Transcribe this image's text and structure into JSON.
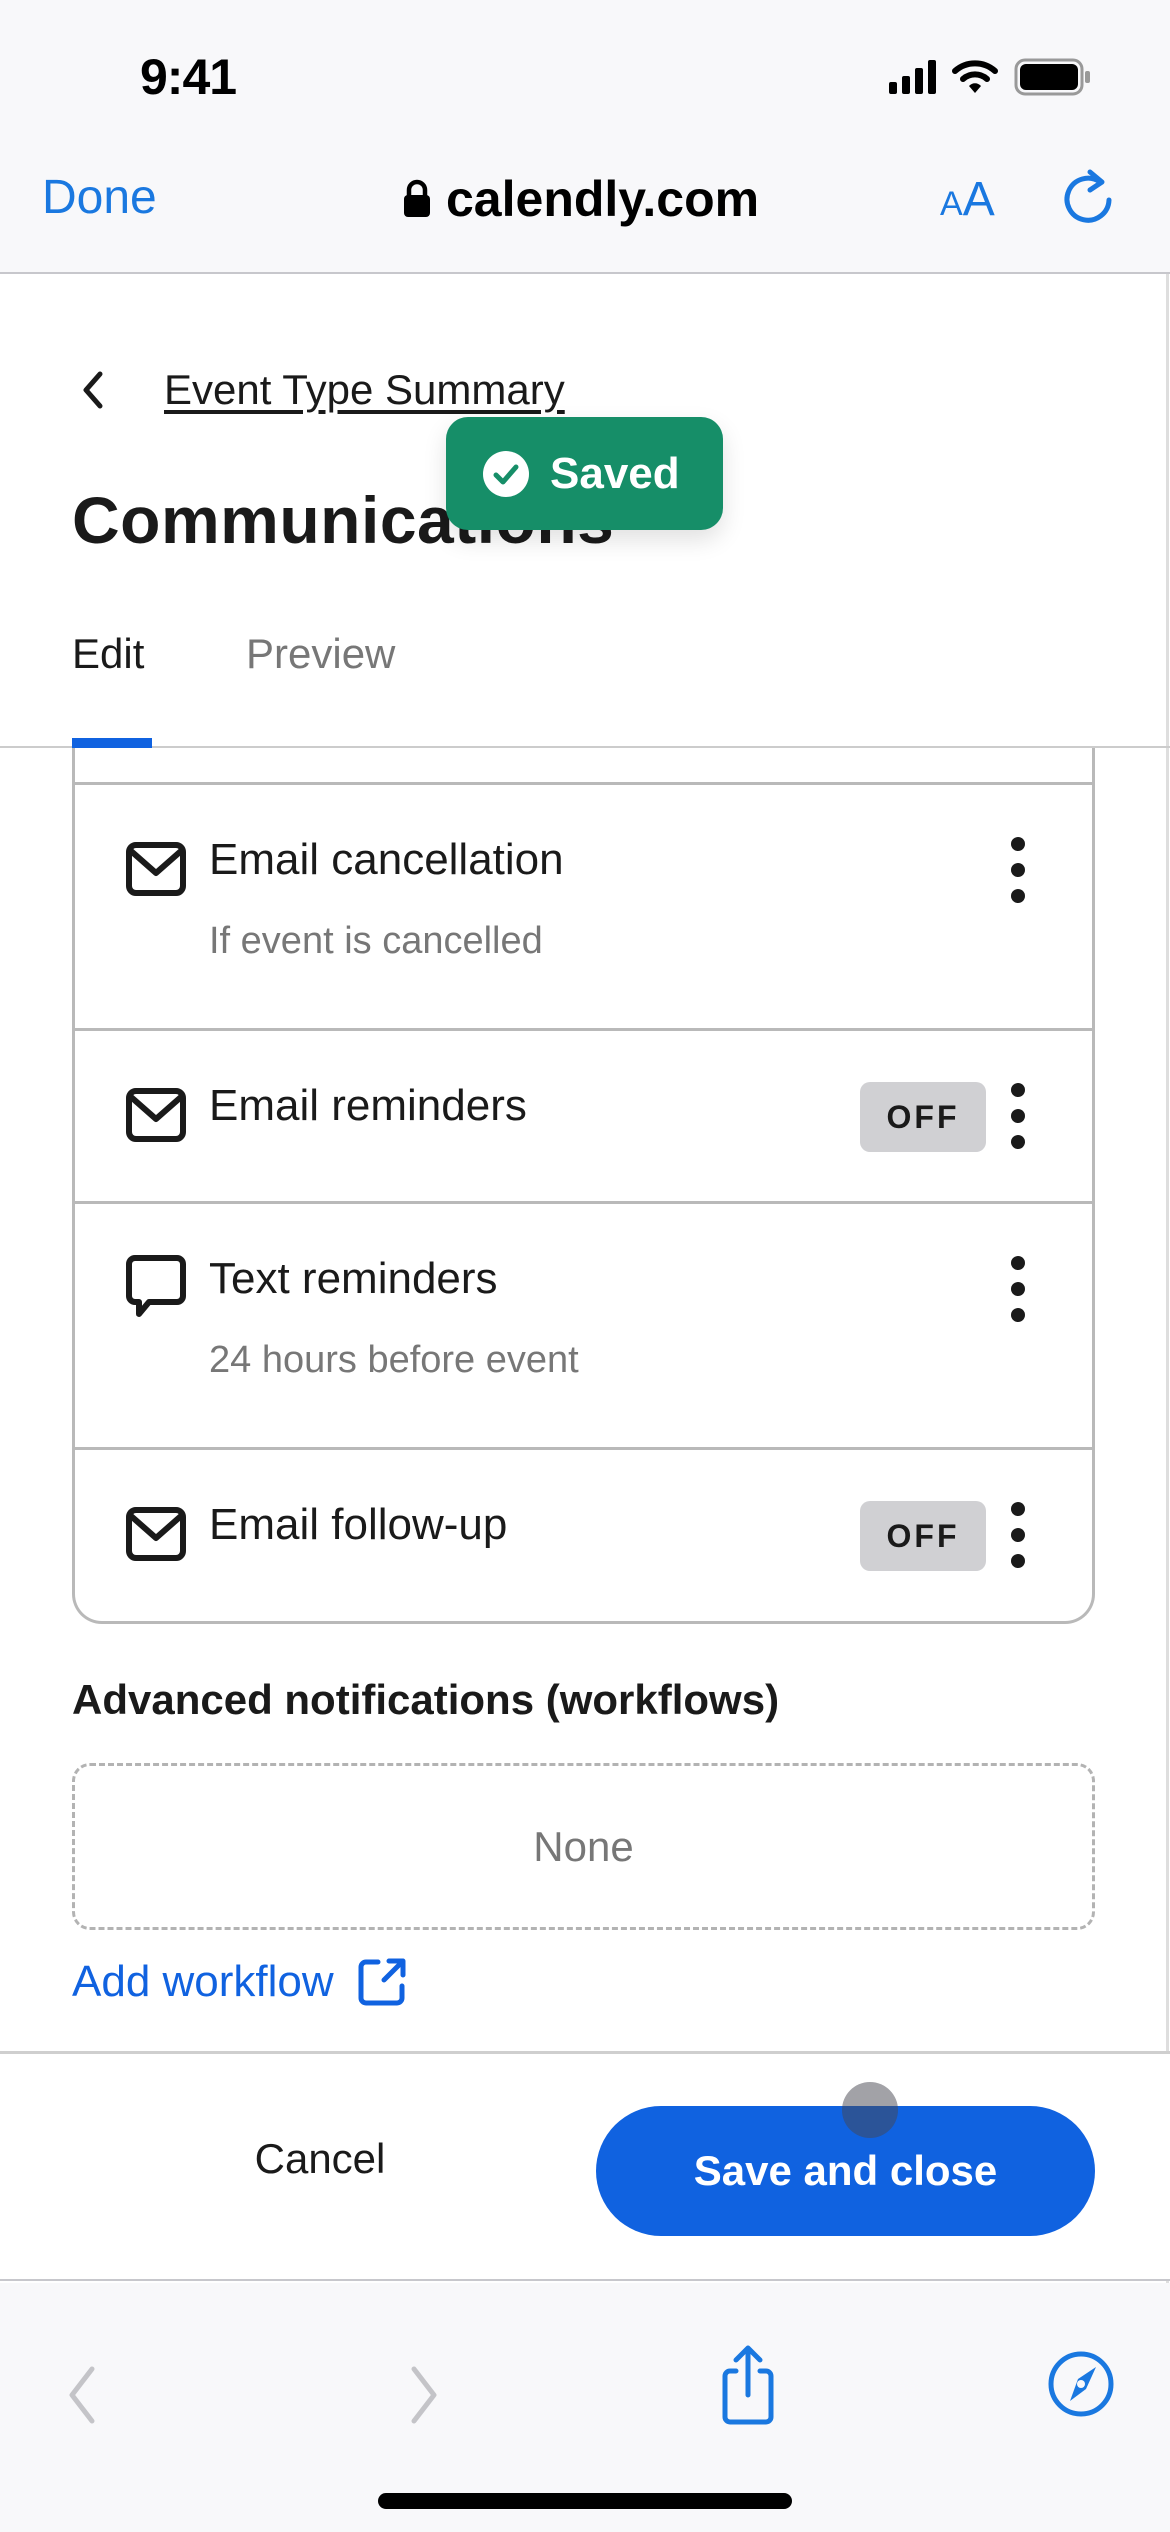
{
  "status_bar": {
    "time": "9:41",
    "icons": [
      "cellular-signal-icon",
      "wifi-icon",
      "battery-icon"
    ]
  },
  "browser": {
    "done_label": "Done",
    "url": "calendly.com",
    "lock_icon": "lock-icon",
    "text_size_label_small": "A",
    "text_size_label_large": "A",
    "reload_icon": "reload-icon",
    "toolbar": {
      "back_icon": "chevron-left-icon",
      "forward_icon": "chevron-right-icon",
      "share_icon": "share-icon",
      "compass_icon": "compass-icon"
    }
  },
  "header": {
    "breadcrumb": "Event Type Summary",
    "title": "Communications"
  },
  "toast": {
    "text": "Saved",
    "icon": "check-circle-icon",
    "color": "#168e68"
  },
  "tabs": [
    {
      "label": "Edit",
      "active": true
    },
    {
      "label": "Preview",
      "active": false
    }
  ],
  "notifications": [
    {
      "icon": "envelope-icon",
      "title": "Email cancellation",
      "subtitle": "If event is cancelled",
      "status": null
    },
    {
      "icon": "envelope-icon",
      "title": "Email reminders",
      "subtitle": null,
      "status": "OFF"
    },
    {
      "icon": "chat-bubble-icon",
      "title": "Text reminders",
      "subtitle": "24 hours before event",
      "status": null
    },
    {
      "icon": "envelope-icon",
      "title": "Email follow-up",
      "subtitle": null,
      "status": "OFF"
    }
  ],
  "advanced": {
    "title": "Advanced notifications (workflows)",
    "empty_text": "None",
    "add_label": "Add workflow",
    "add_icon": "external-link-icon"
  },
  "footer": {
    "cancel_label": "Cancel",
    "save_label": "Save and close"
  },
  "colors": {
    "primary": "#1062e0",
    "ios_blue": "#1a78e0",
    "success": "#168e68",
    "muted_text": "#777777",
    "badge_bg": "#d0d0d3"
  }
}
